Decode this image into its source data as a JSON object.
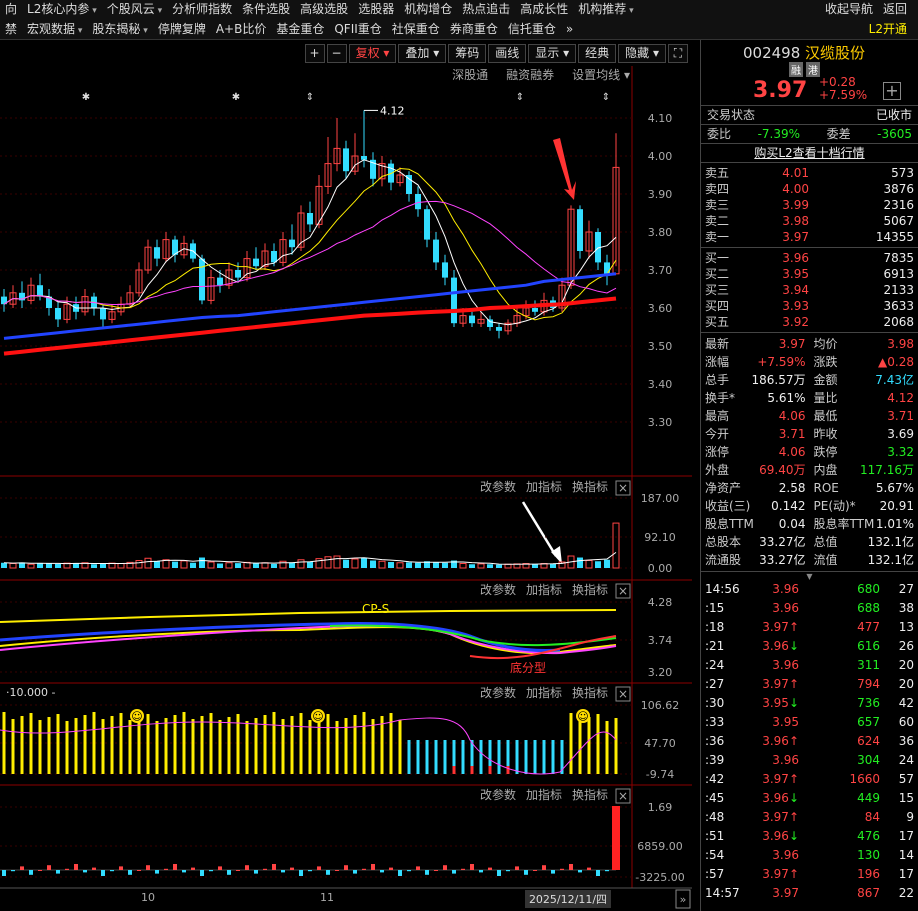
{
  "menu": {
    "row1": [
      "向",
      "L2核心内参",
      "个股风云",
      "分析师指数",
      "条件选股",
      "高级选股",
      "选股器",
      "机构增仓",
      "热点追击",
      "高成长性",
      "机构推荐"
    ],
    "row1_tri": [
      false,
      true,
      true,
      false,
      false,
      false,
      false,
      false,
      false,
      false,
      true
    ],
    "row1_right": [
      "收起导航",
      "返回"
    ],
    "row2": [
      "禁",
      "宏观数据",
      "股东揭秘",
      "停牌复牌",
      "A+B比价",
      "基金重仓",
      "QFII重仓",
      "社保重仓",
      "券商重仓",
      "信托重仓"
    ],
    "row2_tri": [
      false,
      true,
      true,
      false,
      false,
      false,
      false,
      false,
      false,
      false
    ],
    "row2_more": "»",
    "row2_right": "L2开通"
  },
  "toolbar": {
    "items": [
      "+",
      "−",
      "复权",
      "叠加",
      "筹码",
      "画线",
      "显示",
      "经典",
      "隐藏"
    ],
    "expand": "⛶"
  },
  "subbar": [
    "深股通",
    "融资融券",
    "设置均线"
  ],
  "price_axis": [
    "4.10",
    "4.00",
    "3.90",
    "3.80",
    "3.70",
    "3.60",
    "3.50",
    "3.40",
    "3.30"
  ],
  "high_label": "4.12",
  "vol_axis": [
    "187.00",
    "92.10",
    "0.00"
  ],
  "ind1_axis": [
    "4.28",
    "3.74",
    "3.20"
  ],
  "ind2_axis": [
    "106.62",
    "47.70",
    "-9.74"
  ],
  "ind3_axis": [
    "1.69",
    "6859.00",
    "-3225.00"
  ],
  "panel_tools": [
    "改参数",
    "加指标",
    "换指标"
  ],
  "ind1_labels": {
    "cps": "CP-S",
    "bottom": "底分型"
  },
  "ind2_param": "10.000",
  "x_labels": [
    "10",
    "11"
  ],
  "date_label": "2025/12/11/四",
  "stock": {
    "code": "002498",
    "name": "汉缆股份",
    "tags": [
      "融",
      "港"
    ],
    "price": "3.97",
    "change": "+0.28",
    "pct": "+7.59%"
  },
  "status": {
    "label": "交易状态",
    "value": "已收市"
  },
  "weibi": {
    "l1": "委比",
    "v1": "-7.39%",
    "l2": "委差",
    "v2": "-3605"
  },
  "buy_l2": "购买L2查看十档行情",
  "asks": [
    [
      "卖五",
      "4.01",
      "573"
    ],
    [
      "卖四",
      "4.00",
      "3876"
    ],
    [
      "卖三",
      "3.99",
      "2316"
    ],
    [
      "卖二",
      "3.98",
      "5067"
    ],
    [
      "卖一",
      "3.97",
      "14355"
    ]
  ],
  "bids": [
    [
      "买一",
      "3.96",
      "7835"
    ],
    [
      "买二",
      "3.95",
      "6913"
    ],
    [
      "买三",
      "3.94",
      "2133"
    ],
    [
      "买四",
      "3.93",
      "3633"
    ],
    [
      "买五",
      "3.92",
      "2068"
    ]
  ],
  "stats": [
    [
      "最新",
      "3.97",
      "red",
      "均价",
      "3.98",
      "red"
    ],
    [
      "涨幅",
      "+7.59%",
      "red",
      "涨跌",
      "▲0.28",
      "red"
    ],
    [
      "总手",
      "186.57万",
      "white",
      "金额",
      "7.43亿",
      "cyan"
    ],
    [
      "换手*",
      "5.61%",
      "white",
      "量比",
      "4.12",
      "red"
    ],
    [
      "最高",
      "4.06",
      "red",
      "最低",
      "3.71",
      "red"
    ],
    [
      "今开",
      "3.71",
      "red",
      "昨收",
      "3.69",
      "white"
    ],
    [
      "涨停",
      "4.06",
      "red",
      "跌停",
      "3.32",
      "green"
    ],
    [
      "外盘",
      "69.40万",
      "red",
      "内盘",
      "117.16万",
      "green"
    ],
    [
      "净资产",
      "2.58",
      "white",
      "ROE",
      "5.67%",
      "white"
    ],
    [
      "收益(三)",
      "0.142",
      "white",
      "PE(动)*",
      "20.91",
      "white"
    ],
    [
      "股息TTM",
      "0.04",
      "white",
      "股息率TTM",
      "1.01%",
      "white"
    ],
    [
      "总股本",
      "33.27亿",
      "white",
      "总值",
      "132.1亿",
      "white"
    ],
    [
      "流通股",
      "33.27亿",
      "white",
      "流值",
      "132.1亿",
      "white"
    ]
  ],
  "ticks": [
    [
      "14:56",
      "3.96",
      "",
      "680",
      "27",
      "green"
    ],
    [
      ":15",
      "3.96",
      "",
      "688",
      "38",
      "green"
    ],
    [
      ":18",
      "3.97",
      "↑",
      "477",
      "13",
      "red"
    ],
    [
      ":21",
      "3.96",
      "↓",
      "616",
      "26",
      "green"
    ],
    [
      ":24",
      "3.96",
      "",
      "311",
      "20",
      "green"
    ],
    [
      ":27",
      "3.97",
      "↑",
      "794",
      "20",
      "red"
    ],
    [
      ":30",
      "3.95",
      "↓",
      "736",
      "42",
      "green"
    ],
    [
      ":33",
      "3.95",
      "",
      "657",
      "60",
      "green"
    ],
    [
      ":36",
      "3.96",
      "↑",
      "624",
      "36",
      "red"
    ],
    [
      ":39",
      "3.96",
      "",
      "304",
      "24",
      "green"
    ],
    [
      ":42",
      "3.97",
      "↑",
      "1660",
      "57",
      "red"
    ],
    [
      ":45",
      "3.96",
      "↓",
      "449",
      "15",
      "green"
    ],
    [
      ":48",
      "3.97",
      "↑",
      "84",
      "9",
      "red"
    ],
    [
      ":51",
      "3.96",
      "↓",
      "476",
      "17",
      "green"
    ],
    [
      ":54",
      "3.96",
      "",
      "130",
      "14",
      "green"
    ],
    [
      ":57",
      "3.97",
      "↑",
      "196",
      "17",
      "red"
    ],
    [
      "14:57",
      "3.97",
      "",
      "867",
      "22",
      "red"
    ]
  ],
  "candles": [
    [
      3.63,
      3.61,
      3.65,
      3.59
    ],
    [
      3.61,
      3.64,
      3.66,
      3.6
    ],
    [
      3.64,
      3.62,
      3.67,
      3.6
    ],
    [
      3.62,
      3.66,
      3.68,
      3.61
    ],
    [
      3.66,
      3.63,
      3.69,
      3.62
    ],
    [
      3.63,
      3.6,
      3.65,
      3.58
    ],
    [
      3.6,
      3.57,
      3.62,
      3.55
    ],
    [
      3.57,
      3.61,
      3.63,
      3.56
    ],
    [
      3.61,
      3.59,
      3.63,
      3.57
    ],
    [
      3.59,
      3.63,
      3.65,
      3.58
    ],
    [
      3.63,
      3.6,
      3.64,
      3.58
    ],
    [
      3.6,
      3.57,
      3.61,
      3.55
    ],
    [
      3.57,
      3.59,
      3.61,
      3.56
    ],
    [
      3.59,
      3.61,
      3.63,
      3.58
    ],
    [
      3.61,
      3.64,
      3.66,
      3.6
    ],
    [
      3.64,
      3.7,
      3.72,
      3.63
    ],
    [
      3.7,
      3.76,
      3.78,
      3.69
    ],
    [
      3.76,
      3.73,
      3.78,
      3.71
    ],
    [
      3.73,
      3.78,
      3.8,
      3.72
    ],
    [
      3.78,
      3.74,
      3.79,
      3.72
    ],
    [
      3.74,
      3.77,
      3.79,
      3.73
    ],
    [
      3.77,
      3.73,
      3.78,
      3.72
    ],
    [
      3.73,
      3.62,
      3.74,
      3.61
    ],
    [
      3.62,
      3.68,
      3.7,
      3.61
    ],
    [
      3.68,
      3.66,
      3.7,
      3.64
    ],
    [
      3.66,
      3.7,
      3.72,
      3.65
    ],
    [
      3.7,
      3.68,
      3.72,
      3.67
    ],
    [
      3.68,
      3.73,
      3.75,
      3.67
    ],
    [
      3.73,
      3.71,
      3.76,
      3.7
    ],
    [
      3.71,
      3.75,
      3.77,
      3.7
    ],
    [
      3.75,
      3.72,
      3.77,
      3.71
    ],
    [
      3.72,
      3.78,
      3.8,
      3.71
    ],
    [
      3.78,
      3.76,
      3.82,
      3.74
    ],
    [
      3.76,
      3.85,
      3.87,
      3.75
    ],
    [
      3.85,
      3.82,
      3.88,
      3.8
    ],
    [
      3.82,
      3.92,
      3.95,
      3.81
    ],
    [
      3.92,
      3.98,
      4.05,
      3.9
    ],
    [
      3.98,
      4.02,
      4.1,
      3.96
    ],
    [
      4.02,
      3.96,
      4.04,
      3.94
    ],
    [
      3.96,
      4.0,
      4.06,
      3.95
    ],
    [
      4.0,
      3.99,
      4.12,
      3.97
    ],
    [
      3.99,
      3.94,
      4.01,
      3.92
    ],
    [
      3.94,
      3.98,
      4.0,
      3.92
    ],
    [
      3.98,
      3.93,
      3.99,
      3.91
    ],
    [
      3.93,
      3.95,
      3.97,
      3.92
    ],
    [
      3.95,
      3.9,
      3.96,
      3.88
    ],
    [
      3.9,
      3.86,
      3.92,
      3.84
    ],
    [
      3.86,
      3.78,
      3.87,
      3.76
    ],
    [
      3.78,
      3.72,
      3.8,
      3.7
    ],
    [
      3.72,
      3.68,
      3.74,
      3.66
    ],
    [
      3.68,
      3.56,
      3.7,
      3.55
    ],
    [
      3.56,
      3.58,
      3.6,
      3.55
    ],
    [
      3.58,
      3.56,
      3.59,
      3.55
    ],
    [
      3.56,
      3.57,
      3.59,
      3.55
    ],
    [
      3.57,
      3.55,
      3.58,
      3.54
    ],
    [
      3.55,
      3.54,
      3.56,
      3.52
    ],
    [
      3.54,
      3.56,
      3.57,
      3.53
    ],
    [
      3.56,
      3.58,
      3.6,
      3.55
    ],
    [
      3.58,
      3.6,
      3.62,
      3.57
    ],
    [
      3.6,
      3.59,
      3.62,
      3.58
    ],
    [
      3.59,
      3.62,
      3.64,
      3.58
    ],
    [
      3.62,
      3.6,
      3.63,
      3.59
    ],
    [
      3.6,
      3.66,
      3.68,
      3.59
    ],
    [
      3.66,
      3.86,
      3.87,
      3.65
    ],
    [
      3.86,
      3.75,
      3.87,
      3.73
    ],
    [
      3.75,
      3.8,
      3.83,
      3.73
    ],
    [
      3.8,
      3.72,
      3.81,
      3.7
    ],
    [
      3.72,
      3.69,
      3.74,
      3.66
    ],
    [
      3.69,
      3.97,
      4.06,
      3.71
    ]
  ],
  "ma_blue": [
    3.52,
    3.525,
    3.53,
    3.535,
    3.54,
    3.545,
    3.55,
    3.555,
    3.56,
    3.565,
    3.57,
    3.575,
    3.578,
    3.58,
    3.585,
    3.59,
    3.595,
    3.6,
    3.605,
    3.61,
    3.615,
    3.62,
    3.625,
    3.63,
    3.635,
    3.64,
    3.645,
    3.65,
    3.655,
    3.66,
    3.67,
    3.675,
    3.68,
    3.685,
    3.69
  ],
  "ma_red": [
    3.48,
    3.485,
    3.49,
    3.495,
    3.5,
    3.505,
    3.51,
    3.515,
    3.52,
    3.525,
    3.53,
    3.535,
    3.54,
    3.545,
    3.55,
    3.555,
    3.56,
    3.565,
    3.57,
    3.575,
    3.58,
    3.582,
    3.585,
    3.588,
    3.59,
    3.592,
    3.595,
    3.6,
    3.602,
    3.605,
    3.608,
    3.61,
    3.615,
    3.62,
    3.625
  ],
  "volumes": [
    14,
    12,
    15,
    10,
    13,
    12,
    11,
    13,
    12,
    14,
    10,
    11,
    13,
    12,
    15,
    20,
    26,
    18,
    22,
    17,
    19,
    14,
    28,
    16,
    12,
    14,
    13,
    15,
    12,
    14,
    11,
    18,
    15,
    22,
    17,
    25,
    30,
    32,
    22,
    24,
    28,
    20,
    18,
    16,
    14,
    15,
    14,
    18,
    16,
    14,
    20,
    12,
    10,
    11,
    10,
    9,
    10,
    11,
    12,
    10,
    12,
    11,
    16,
    32,
    28,
    20,
    18,
    22,
    120
  ],
  "xmark_icons": [
    "star",
    "star",
    "updown",
    "updown"
  ]
}
